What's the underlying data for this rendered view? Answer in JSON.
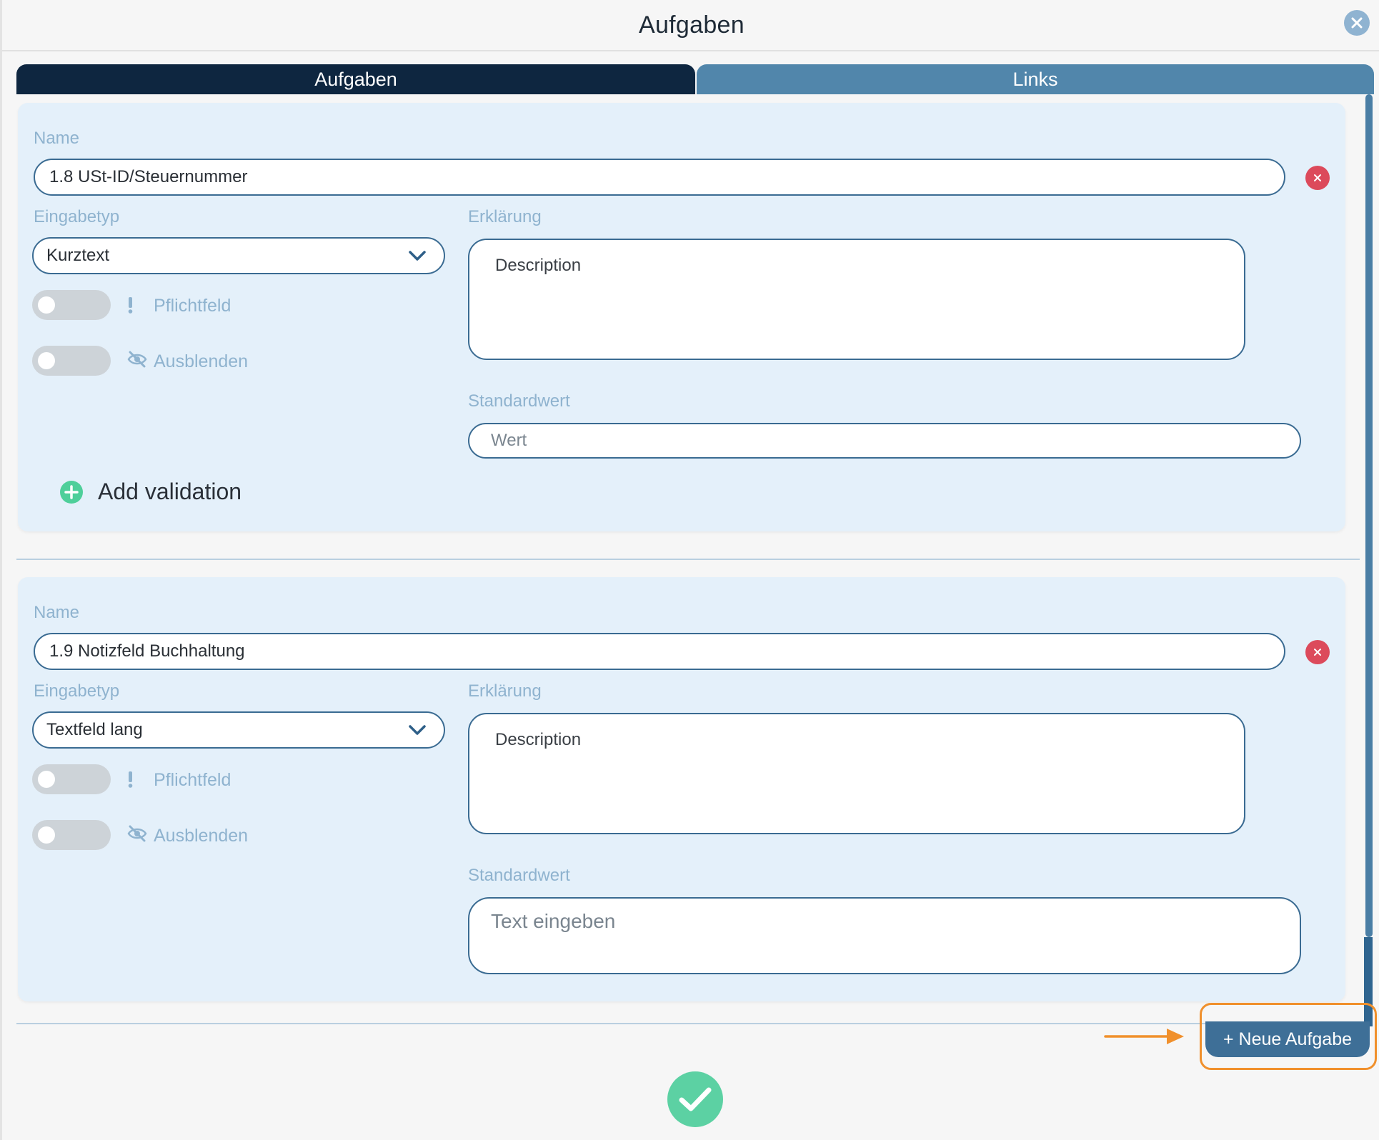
{
  "dialog": {
    "title": "Aufgaben"
  },
  "tabs": [
    {
      "label": "Aufgaben",
      "active": true
    },
    {
      "label": "Links",
      "active": false
    }
  ],
  "tasks": [
    {
      "name_label": "Name",
      "name_value": "1.8 USt-ID/Steuernummer",
      "input_type_label": "Eingabetyp",
      "input_type_value": "Kurztext",
      "explanation_label": "Erklärung",
      "explanation_placeholder": "Description",
      "required_label": "Pflichtfeld",
      "hide_label": "Ausblenden",
      "default_label": "Standardwert",
      "default_placeholder": "Wert",
      "add_validation_label": "Add validation"
    },
    {
      "name_label": "Name",
      "name_value": "1.9 Notizfeld Buchhaltung",
      "input_type_label": "Eingabetyp",
      "input_type_value": "Textfeld lang",
      "explanation_label": "Erklärung",
      "explanation_placeholder": "Description",
      "required_label": "Pflichtfeld",
      "hide_label": "Ausblenden",
      "default_label": "Standardwert",
      "default_placeholder": "Text eingeben"
    }
  ],
  "footer": {
    "new_task_label": "+ Neue Aufgabe"
  },
  "colors": {
    "accent_dark": "#0e2640",
    "tab_inactive": "#5186ab",
    "card_bg": "#e4f0fa",
    "delete": "#dc4a5b",
    "add": "#4ecf9a",
    "confirm": "#5cd1a3",
    "highlight": "#f0902c"
  },
  "icons": {
    "close": "close-icon",
    "delete": "x-circle-icon",
    "chevron": "chevron-down-icon",
    "required": "exclamation-icon",
    "hide": "eye-slash-icon",
    "add": "plus-circle-icon",
    "confirm": "checkmark-icon",
    "arrow": "arrow-right-icon"
  }
}
